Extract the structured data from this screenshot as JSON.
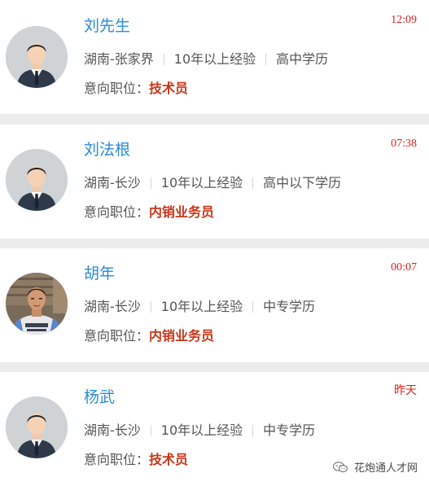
{
  "candidates": [
    {
      "name": "刘先生",
      "time": "12:09",
      "location": "湖南-张家界",
      "experience": "10年以上经验",
      "education": "高中学历",
      "job_label": "意向职位：",
      "job": "技术员",
      "avatar": "default-avatar"
    },
    {
      "name": "刘法根",
      "time": "07:38",
      "location": "湖南-长沙",
      "experience": "10年以上经验",
      "education": "高中以下学历",
      "job_label": "意向职位：",
      "job": "内销业务员",
      "avatar": "default-avatar"
    },
    {
      "name": "胡年",
      "time": "00:07",
      "location": "湖南-长沙",
      "experience": "10年以上经验",
      "education": "中专学历",
      "job_label": "意向职位：",
      "job": "内销业务员",
      "avatar": "photo-avatar"
    },
    {
      "name": "杨武",
      "time": "昨天",
      "location": "湖南-长沙",
      "experience": "10年以上经验",
      "education": "中专学历",
      "job_label": "意向职位：",
      "job": "技术员",
      "avatar": "default-avatar"
    }
  ],
  "watermark": {
    "icon": "wechat-icon",
    "text": "花炮通人才网"
  },
  "colors": {
    "name": "#2a8bd8",
    "time": "#e01e1e",
    "job_value": "#c8361a",
    "divider": "#ececec"
  }
}
